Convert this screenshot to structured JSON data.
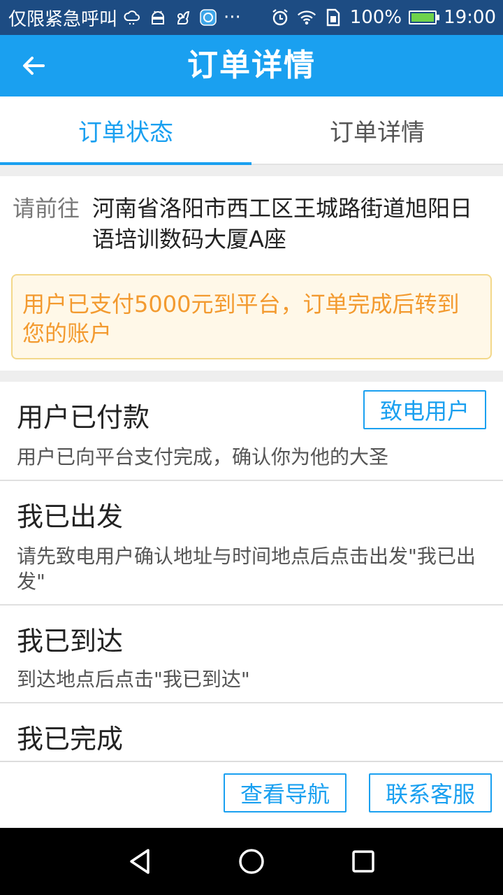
{
  "status_bar": {
    "carrier": "仅限紧急呼叫",
    "battery_percent": "100%",
    "battery_level": 1.0,
    "time": "19:00",
    "more": "···"
  },
  "app_bar": {
    "title": "订单详情"
  },
  "tabs": [
    {
      "label": "订单状态",
      "active": true
    },
    {
      "label": "订单详情",
      "active": false
    }
  ],
  "address": {
    "label": "请前往",
    "text": "河南省洛阳市西工区王城路街道旭阳日语培训数码大厦A座"
  },
  "notice": {
    "text": "用户已支付5000元到平台，订单完成后转到您的账户"
  },
  "steps": [
    {
      "title": "用户已付款",
      "desc": "用户已向平台支付完成，确认你为他的大圣",
      "button": "致电用户"
    },
    {
      "title": "我已出发",
      "desc": "请先致电用户确认地址与时间地点后点击出发\"我已出发\""
    },
    {
      "title": "我已到达",
      "desc": "到达地点后点击\"我已到达\""
    },
    {
      "title": "我已完成",
      "desc": ""
    }
  ],
  "actions": {
    "navigate": "查看导航",
    "support": "联系客服"
  },
  "colors": {
    "primary": "#1aa0f0",
    "status_bar": "#1d4c83",
    "notice_text": "#f39a2f",
    "notice_bg": "#fff8e8",
    "notice_border": "#f3d88a"
  }
}
